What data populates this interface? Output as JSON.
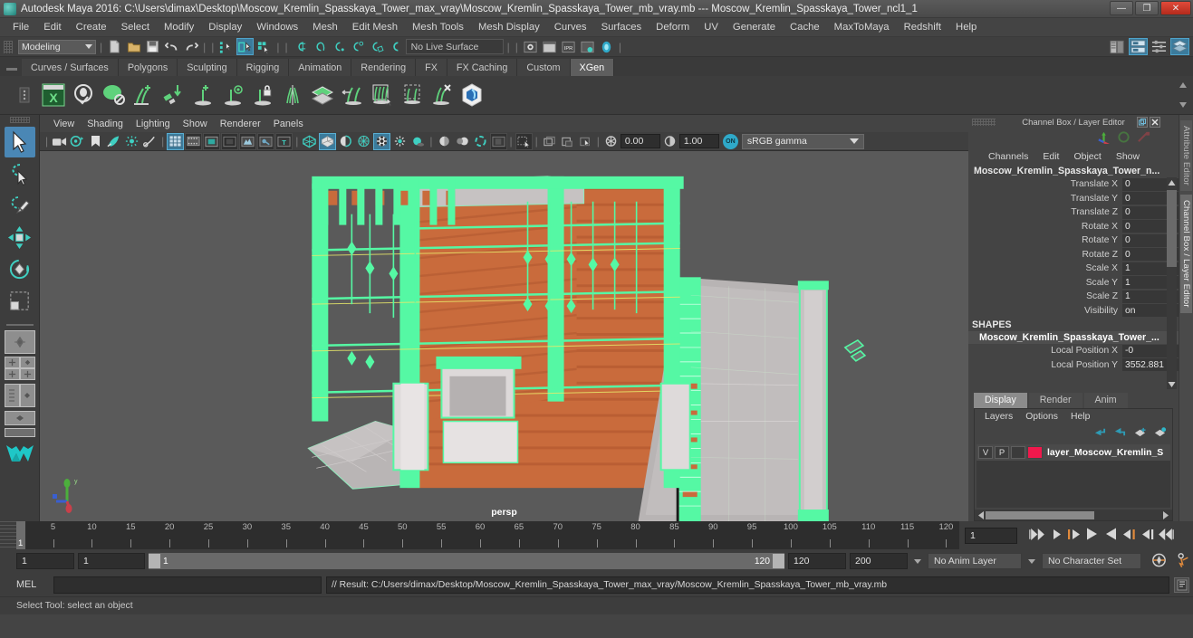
{
  "titlebar": {
    "app_title": "Autodesk Maya 2016: C:\\Users\\dimax\\Desktop\\Moscow_Kremlin_Spasskaya_Tower_max_vray\\Moscow_Kremlin_Spasskaya_Tower_mb_vray.mb  ---  Moscow_Kremlin_Spasskaya_Tower_ncl1_1",
    "minimize": "—",
    "restore": "❐",
    "close": "✕"
  },
  "menubar": {
    "items": [
      "File",
      "Edit",
      "Create",
      "Select",
      "Modify",
      "Display",
      "Windows",
      "Mesh",
      "Edit Mesh",
      "Mesh Tools",
      "Mesh Display",
      "Curves",
      "Surfaces",
      "Deform",
      "UV",
      "Generate",
      "Cache",
      "MaxToMaya",
      "Redshift",
      "Help"
    ]
  },
  "statusline": {
    "mode": "Modeling",
    "live_surface": "No Live Surface",
    "icons": [
      "new-scene-icon",
      "open-scene-icon",
      "save-scene-icon",
      "undo-icon",
      "redo-icon",
      "select-by-hierarchy-icon",
      "select-by-object-icon",
      "select-by-component-icon",
      "snap-to-grid-icon",
      "snap-to-curve-icon",
      "snap-to-point-icon",
      "snap-to-projected-center-icon",
      "snap-to-view-plane-icon",
      "make-live-icon"
    ],
    "right_icons": [
      "render-view-icon",
      "render-sequence-icon",
      "ipr-render-icon",
      "render-settings-icon",
      "hypershade-icon",
      "open-attribute-editor-icon",
      "open-tool-settings-icon",
      "open-channel-box-icon",
      "open-outliner-icon"
    ]
  },
  "shelf": {
    "tabs": [
      "Curves / Surfaces",
      "Polygons",
      "Sculpting",
      "Rigging",
      "Animation",
      "Rendering",
      "FX",
      "FX Caching",
      "Custom",
      "XGen"
    ],
    "active_tab": "XGen",
    "icons": [
      "xgen-editor-icon",
      "xgen-preview-icon",
      "xgen-disable-preview-icon",
      "xgen-add-groom-icon",
      "xgen-convert-icon",
      "xgen-add-guide-icon",
      "xgen-show-guide-icon",
      "xgen-lock-guide-icon",
      "xgen-mirror-guide-icon",
      "xgen-layer-icon",
      "xgen-length-icon",
      "xgen-density-icon",
      "xgen-region-icon",
      "xgen-delete-guide-icon",
      "xgen-interactive-groom-icon"
    ]
  },
  "toolbox": {
    "tools": [
      {
        "name": "select-tool",
        "selected": true
      },
      {
        "name": "lasso-select-tool",
        "selected": false
      },
      {
        "name": "paint-select-tool",
        "selected": false
      },
      {
        "name": "move-tool",
        "selected": false
      },
      {
        "name": "rotate-tool",
        "selected": false
      },
      {
        "name": "scale-tool",
        "selected": false
      }
    ],
    "layout_buttons": [
      "single-perspective-layout",
      "four-view-layout",
      "two-pane-side-layout",
      "two-pane-stacked-layout",
      "persp-outliner-layout",
      "hypershade-layout",
      "maya-logo"
    ]
  },
  "viewport": {
    "menus": [
      "View",
      "Shading",
      "Lighting",
      "Show",
      "Renderer",
      "Panels"
    ],
    "toolbar": {
      "exposure": "0.00",
      "gamma": "1.00",
      "color_management_badge": "ON",
      "color_profile": "sRGB gamma",
      "icons": [
        "select-camera-icon",
        "camera-attributes-icon",
        "bookmark-icon",
        "image-plane-icon",
        "two-sided-lighting-icon",
        "paint-effects-icon",
        "grid-icon",
        "film-gate-icon",
        "resolution-gate-icon",
        "gate-mask-icon",
        "xray-icon",
        "xray-joints-icon",
        "texture-icon",
        "wireframe-icon",
        "smooth-shade-all-icon",
        "shade-options-icon",
        "wireframe-on-shaded-icon",
        "textured-icon",
        "use-all-lights-icon",
        "shadows-icon",
        "screen-space-ao-icon",
        "motion-blur-icon",
        "multisample-icon",
        "isolate-select-icon",
        "grid-toggle-icon"
      ]
    },
    "camera_label": "persp",
    "axis": {
      "x": "x",
      "y": "y",
      "z": "z"
    },
    "colors": {
      "background": "#5a5a5a",
      "selection_green": "#55f8a4",
      "brick_orange": "#c96a3a",
      "stone_grey": "#c9c5c5"
    }
  },
  "channelbox": {
    "panel_title": "Channel Box / Layer Editor",
    "menus": [
      "Channels",
      "Edit",
      "Object",
      "Show"
    ],
    "node_name": "Moscow_Kremlin_Spasskaya_Tower_n...",
    "transform_rows": [
      {
        "label": "Translate X",
        "value": "0"
      },
      {
        "label": "Translate Y",
        "value": "0"
      },
      {
        "label": "Translate Z",
        "value": "0"
      },
      {
        "label": "Rotate X",
        "value": "0"
      },
      {
        "label": "Rotate Y",
        "value": "0"
      },
      {
        "label": "Rotate Z",
        "value": "0"
      },
      {
        "label": "Scale X",
        "value": "1"
      },
      {
        "label": "Scale Y",
        "value": "1"
      },
      {
        "label": "Scale Z",
        "value": "1"
      },
      {
        "label": "Visibility",
        "value": "on"
      }
    ],
    "shapes_header": "SHAPES",
    "shape_name": "Moscow_Kremlin_Spasskaya_Tower_...",
    "shape_rows": [
      {
        "label": "Local Position X",
        "value": "-0"
      },
      {
        "label": "Local Position Y",
        "value": "3552.881"
      }
    ]
  },
  "layereditor": {
    "tabs": [
      "Display",
      "Render",
      "Anim"
    ],
    "active_tab": "Display",
    "menus": [
      "Layers",
      "Options",
      "Help"
    ],
    "toolbar_icons": [
      "move-layer-up-icon",
      "move-layer-down-icon",
      "new-layer-icon",
      "new-layer-from-selected-icon"
    ],
    "layers": [
      {
        "visibility": "V",
        "playback": "P",
        "type": "",
        "color": "#f0184c",
        "name": "layer_Moscow_Kremlin_S"
      }
    ]
  },
  "sidetabs": {
    "items": [
      "Attribute Editor",
      "Channel Box / Layer Editor"
    ]
  },
  "timeline": {
    "ticks": [
      5,
      10,
      15,
      20,
      25,
      30,
      35,
      40,
      45,
      50,
      55,
      60,
      65,
      70,
      75,
      80,
      85,
      90,
      95,
      100,
      105,
      110,
      115,
      120
    ],
    "current_frame": "1",
    "start": 1,
    "end": 120,
    "playback_field": "1",
    "transport_icons": [
      "go-to-start-icon",
      "step-back-keyframe-icon",
      "step-back-frame-icon",
      "play-backwards-icon",
      "play-forwards-icon",
      "step-forward-frame-icon",
      "step-forward-keyframe-icon",
      "go-to-end-icon"
    ]
  },
  "rangeslider": {
    "anim_start": "1",
    "range_start": "1",
    "bar_left_value": "1",
    "bar_right_value": "120",
    "range_end": "120",
    "anim_end": "200",
    "anim_layer": "No Anim Layer",
    "character_set": "No Character Set",
    "right_icons": [
      "auto-keyframe-icon",
      "animation-preferences-icon"
    ]
  },
  "commandline": {
    "language_label": "MEL",
    "input_value": "",
    "result_text": "// Result: C:/Users/dimax/Desktop/Moscow_Kremlin_Spasskaya_Tower_max_vray/Moscow_Kremlin_Spasskaya_Tower_mb_vray.mb",
    "script_editor_icon": "script-editor-icon"
  },
  "helpline": {
    "text": "Select Tool: select an object"
  }
}
